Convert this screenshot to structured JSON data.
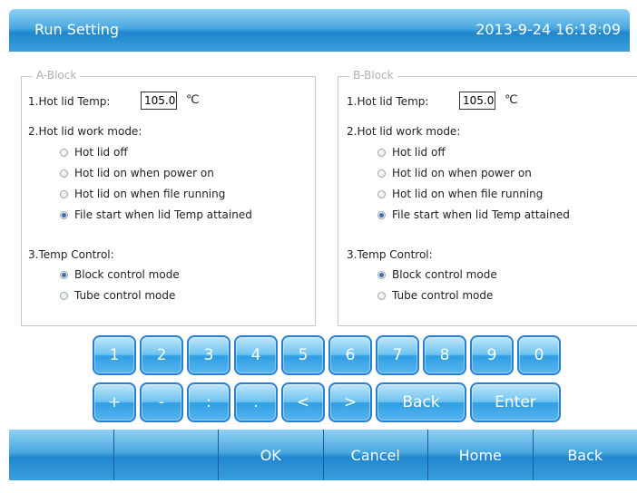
{
  "header": {
    "title": "Run Setting",
    "datetime": "2013-9-24 16:18:09"
  },
  "blocks": [
    {
      "legend": "A-Block",
      "hot_lid_temp_label": "1.Hot lid Temp:",
      "hot_lid_temp_value": "105.0",
      "unit": "℃",
      "work_mode_label": "2.Hot lid work mode:",
      "work_modes": [
        "Hot lid off",
        "Hot lid on when power on",
        "Hot lid on when file running",
        "File start when lid Temp attained"
      ],
      "work_mode_selected": 3,
      "temp_control_label": "3.Temp Control:",
      "temp_controls": [
        "Block control mode",
        "Tube control mode"
      ],
      "temp_control_selected": 0
    },
    {
      "legend": "B-Block",
      "hot_lid_temp_label": "1.Hot lid Temp:",
      "hot_lid_temp_value": "105.0",
      "unit": "℃",
      "work_mode_label": "2.Hot lid work mode:",
      "work_modes": [
        "Hot lid off",
        "Hot lid on when power on",
        "Hot lid on when file running",
        "File start when lid Temp attained"
      ],
      "work_mode_selected": 3,
      "temp_control_label": "3.Temp Control:",
      "temp_controls": [
        "Block control mode",
        "Tube control mode"
      ],
      "temp_control_selected": 0
    }
  ],
  "keypad": {
    "row1": [
      "1",
      "2",
      "3",
      "4",
      "5",
      "6",
      "7",
      "8",
      "9",
      "0"
    ],
    "row2": [
      "+",
      "-",
      ":",
      ".",
      "<",
      ">"
    ],
    "back": "Back",
    "enter": "Enter"
  },
  "bottom_bar": [
    "",
    "",
    "OK",
    "Cancel",
    "Home",
    "Back"
  ],
  "colors": {
    "header_blue": "#1f86cf",
    "key_blue": "#2f9ee4",
    "radio_selected": "#3b6fb5"
  }
}
